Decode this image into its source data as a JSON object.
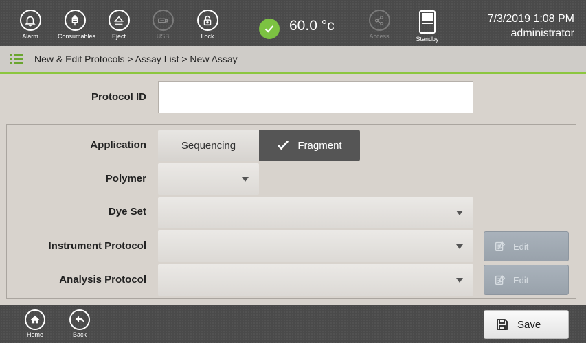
{
  "topbar": {
    "alarm_label": "Alarm",
    "consumables_label": "Consumables",
    "eject_label": "Eject",
    "usb_label": "USB",
    "lock_label": "Lock",
    "temperature": "60.0 °c",
    "access_label": "Access",
    "standby_label": "Standby",
    "datetime": "7/3/2019 1:08 PM",
    "user": "administrator"
  },
  "breadcrumb": {
    "path": "New & Edit Protocols > Assay List > New Assay"
  },
  "form": {
    "protocol_id_label": "Protocol ID",
    "protocol_id_value": "",
    "application_label": "Application",
    "application_options": [
      "Sequencing",
      "Fragment"
    ],
    "application_selected": "Fragment",
    "polymer_label": "Polymer",
    "polymer_value": "",
    "dye_set_label": "Dye Set",
    "dye_set_value": "",
    "instrument_protocol_label": "Instrument Protocol",
    "instrument_protocol_value": "",
    "analysis_protocol_label": "Analysis Protocol",
    "analysis_protocol_value": "",
    "edit_label": "Edit"
  },
  "bottombar": {
    "home_label": "Home",
    "back_label": "Back",
    "save_label": "Save"
  },
  "colors": {
    "accent_green": "#8cc63f",
    "status_green": "#7cc242",
    "bar_dark": "#4a4a4a",
    "background": "#d8d3cd",
    "selected_segment": "#555555",
    "disabled_button": "#a9b2bb"
  },
  "icons": {
    "alarm": "bell-icon",
    "consumables": "consumables-icon",
    "eject": "eject-icon",
    "usb": "usb-icon",
    "lock": "lock-icon",
    "temperature_status": "checkmark-icon",
    "access": "share-icon",
    "standby": "standby-icon",
    "menu": "list-menu-icon",
    "edit": "edit-document-icon",
    "home": "home-icon",
    "back": "back-arrow-icon",
    "save": "floppy-disk-icon"
  }
}
